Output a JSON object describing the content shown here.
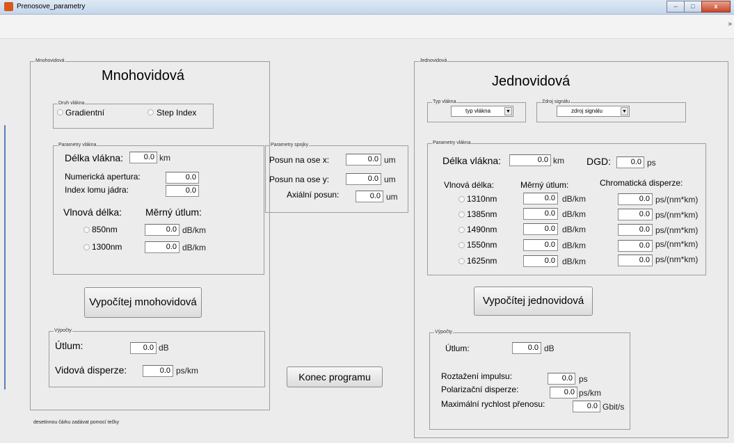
{
  "window": {
    "title": "Prenosove_parametry",
    "minimize": "–",
    "maximize": "□",
    "close": "x"
  },
  "multi": {
    "legend": "Mnohovidová",
    "heading": "Mnohovidová",
    "fiber_type": {
      "legend": "Druh vlákna",
      "options": [
        "Gradientní",
        "Step Index"
      ]
    },
    "params": {
      "legend": "Parametry vlákna",
      "length_label": "Délka vlákna:",
      "length_value": "0.0",
      "length_unit": "km",
      "na_label": "Numerická apertura:",
      "na_value": "0.0",
      "index_label": "Index lomu jádra:",
      "index_value": "0.0",
      "wl_header": "Vlnová délka:",
      "att_header": "Měrný útlum:",
      "rows": [
        {
          "wl": "850nm",
          "value": "0.0",
          "unit": "dB/km"
        },
        {
          "wl": "1300nm",
          "value": "0.0",
          "unit": "dB/km"
        }
      ]
    },
    "compute_button": "Vypočítej mnohovidová",
    "results": {
      "legend": "Výpočty",
      "att_label": "Útlum:",
      "att_value": "0.0",
      "att_unit": "dB",
      "disp_label": "Vidová disperze:",
      "disp_value": "0.0",
      "disp_unit": "ps/km"
    },
    "note": "desetinnou čárku zadávat pomocí tečky"
  },
  "joint": {
    "legend": "Parametry spojky",
    "x_label": "Posun na ose x:",
    "x_value": "0.0",
    "x_unit": "um",
    "y_label": "Posun na ose y:",
    "y_value": "0.0",
    "y_unit": "um",
    "z_label": "Axiální posun:",
    "z_value": "0.0",
    "z_unit": "um"
  },
  "exit_button": "Konec programu",
  "single": {
    "legend": "Jednovidová",
    "heading": "Jednovidová",
    "fiber_type": {
      "legend": "Typ vlákna",
      "selected": "typ vlákna"
    },
    "source": {
      "legend": "Zdroj signálu",
      "selected": "zdroj signálu"
    },
    "params": {
      "legend": "Parametry vlákna",
      "length_label": "Délka vlákna:",
      "length_value": "0.0",
      "length_unit": "km",
      "dgd_label": "DGD:",
      "dgd_value": "0.0",
      "dgd_unit": "ps",
      "wl_header": "Vlnová délka:",
      "att_header": "Měrný útlum:",
      "cd_header": "Chromatická disperze:",
      "rows": [
        {
          "wl": "1310nm",
          "att": "0.0",
          "att_unit": "dB/km",
          "cd": "0.0",
          "cd_unit": "ps/(nm*km)"
        },
        {
          "wl": "1385nm",
          "att": "0.0",
          "att_unit": "dB/km",
          "cd": "0.0",
          "cd_unit": "ps/(nm*km)"
        },
        {
          "wl": "1490nm",
          "att": "0.0",
          "att_unit": "dB/km",
          "cd": "0.0",
          "cd_unit": "ps/(nm*km)"
        },
        {
          "wl": "1550nm",
          "att": "0.0",
          "att_unit": "dB/km",
          "cd": "0.0",
          "cd_unit": "ps/(nm*km)"
        },
        {
          "wl": "1625nm",
          "att": "0.0",
          "att_unit": "dB/km",
          "cd": "0.0",
          "cd_unit": "ps/(nm*km)"
        }
      ]
    },
    "compute_button": "Vypočítej jednovidová",
    "results": {
      "legend": "Výpočty",
      "att_label": "Útlum:",
      "att_value": "0.0",
      "att_unit": "dB",
      "spread_label": "Roztažení impulsu:",
      "spread_value": "0.0",
      "spread_unit": "ps",
      "pmd_label": "Polarizační disperze:",
      "pmd_value": "0.0",
      "pmd_unit": "ps/km",
      "rate_label": "Maximální rychlost přenosu:",
      "rate_value": "0.0",
      "rate_unit": "Gbit/s"
    }
  }
}
